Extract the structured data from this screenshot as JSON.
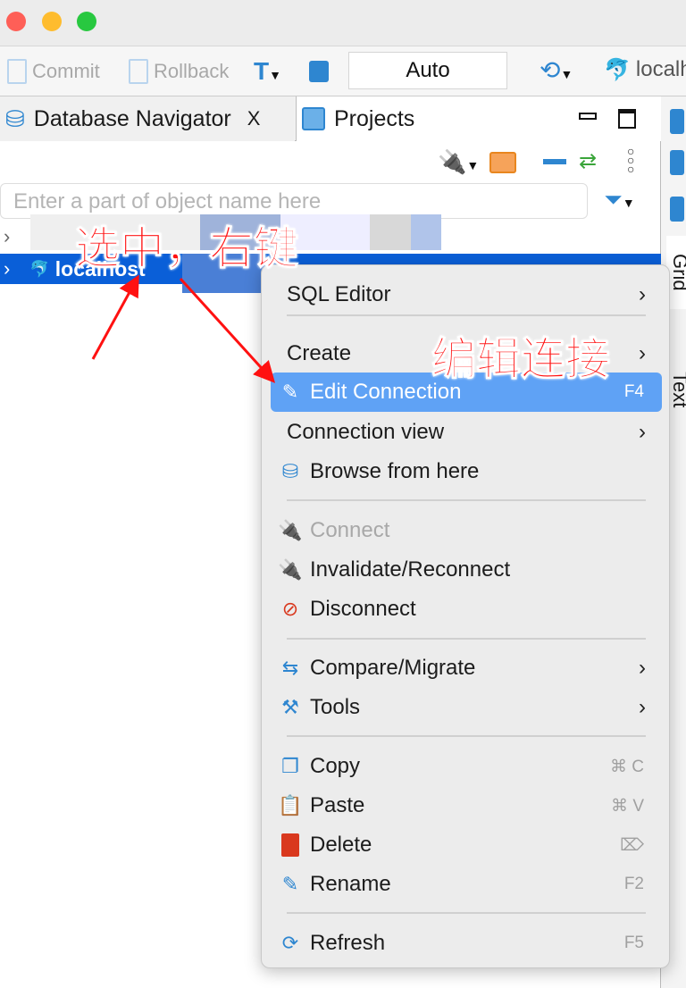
{
  "window": {
    "controls": [
      "close",
      "minimize",
      "maximize"
    ]
  },
  "toolbar": {
    "commit": "Commit",
    "rollback": "Rollback",
    "mode": "Auto",
    "connection": "localh"
  },
  "tabs": [
    {
      "label": "Database Navigator",
      "close": "X"
    },
    {
      "label": "Projects"
    }
  ],
  "search": {
    "placeholder": "Enter a part of object name here"
  },
  "tree": {
    "selected": "localhost"
  },
  "side_tabs": [
    "Grid",
    "Text"
  ],
  "menu": {
    "items": [
      {
        "label": "SQL Editor",
        "submenu": true
      },
      {
        "label": "Create",
        "submenu": true
      },
      {
        "label": "Edit Connection",
        "shortcut": "F4",
        "icon": "pencil-icon",
        "highlighted": true
      },
      {
        "label": "Connection view",
        "submenu": true
      },
      {
        "label": "Browse from here",
        "icon": "database-icon"
      },
      {
        "label": "Connect",
        "icon": "plug-icon",
        "disabled": true
      },
      {
        "label": "Invalidate/Reconnect",
        "icon": "plug-refresh-icon"
      },
      {
        "label": "Disconnect",
        "icon": "plug-off-icon"
      },
      {
        "label": "Compare/Migrate",
        "icon": "compare-icon",
        "submenu": true
      },
      {
        "label": "Tools",
        "icon": "tools-icon",
        "submenu": true
      },
      {
        "label": "Copy",
        "shortcut": "⌘ C",
        "icon": "copy-icon"
      },
      {
        "label": "Paste",
        "shortcut": "⌘ V",
        "icon": "paste-icon"
      },
      {
        "label": "Delete",
        "shortcut": "⌦",
        "icon": "trash-icon"
      },
      {
        "label": "Rename",
        "shortcut": "F2",
        "icon": "rename-icon"
      },
      {
        "label": "Refresh",
        "shortcut": "F5",
        "icon": "refresh-icon"
      }
    ]
  },
  "annotations": {
    "select_right_click": "选中，右键",
    "edit_connection": "编辑连接"
  },
  "colors": {
    "selection": "#0a5fd8",
    "menu_highlight": "#5fa2f5",
    "annotation": "#ff1111"
  }
}
